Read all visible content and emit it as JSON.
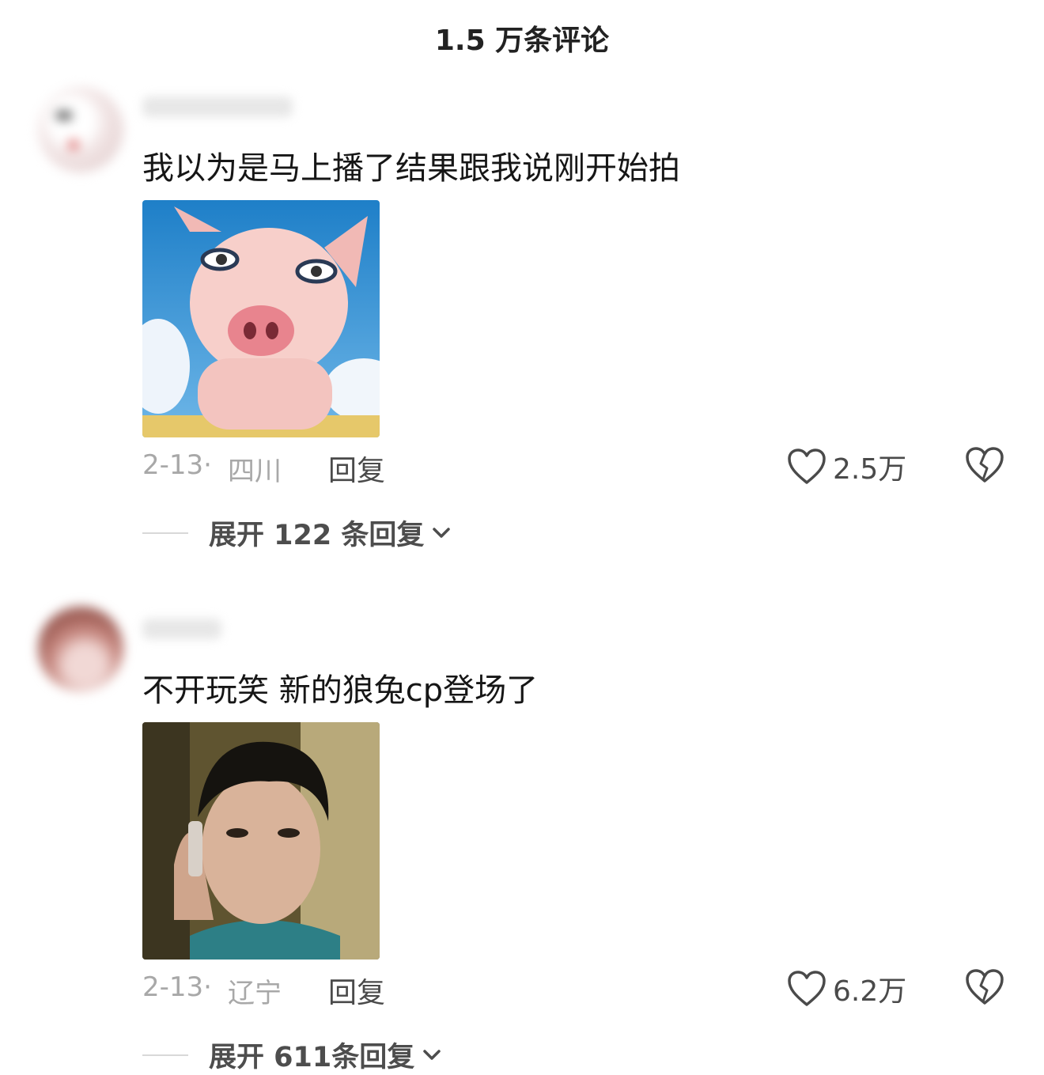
{
  "header": {
    "title": "1.5 万条评论"
  },
  "comments": [
    {
      "text": "我以为是马上播了结果跟我说刚开始拍",
      "date": "2-13·",
      "location": "四川",
      "reply_label": "回复",
      "likes": "2.5万",
      "expand_label": "展开 122 条回复",
      "image_icon": "pig-meme-image"
    },
    {
      "text": "不开玩笑 新的狼兔cp登场了",
      "date": "2-13·",
      "location": "辽宁",
      "reply_label": "回复",
      "likes": "6.2万",
      "expand_label": "展开 611条回复",
      "image_icon": "man-on-phone-meme-image"
    }
  ]
}
